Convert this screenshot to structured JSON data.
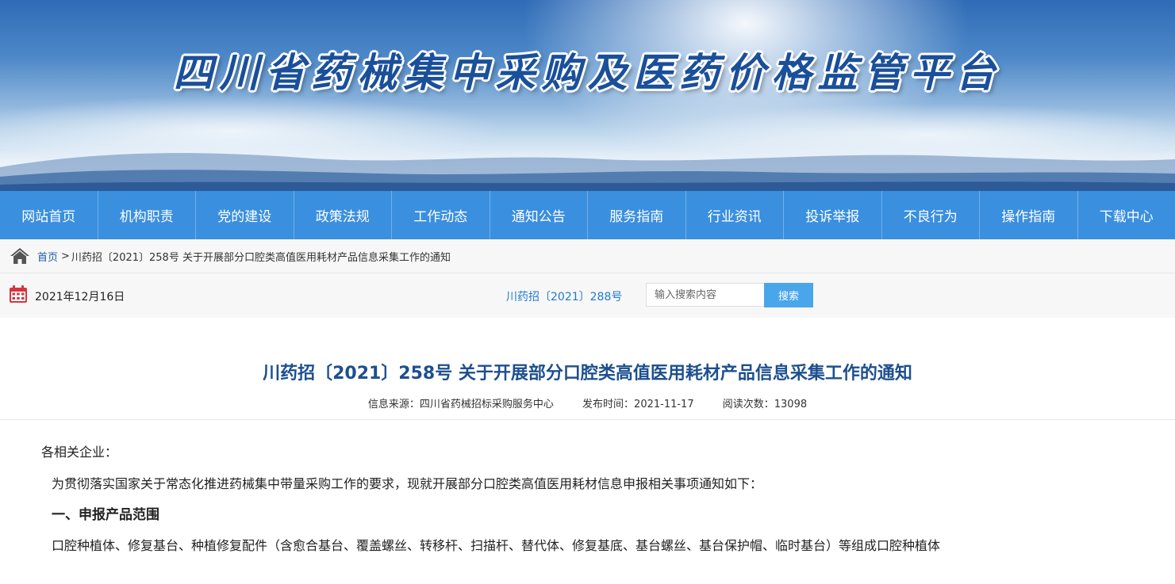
{
  "site": {
    "title": "四川省药械集中采购及医药价格监管平台"
  },
  "nav": {
    "items": [
      "网站首页",
      "机构职责",
      "党的建设",
      "政策法规",
      "工作动态",
      "通知公告",
      "服务指南",
      "行业资讯",
      "投诉举报",
      "不良行为",
      "操作指南",
      "下载中心"
    ]
  },
  "breadcrumb": {
    "home": "首页",
    "separator": ">",
    "current": "川药招〔2021〕258号 关于开展部分口腔类高值医用耗材产品信息采集工作的通知"
  },
  "toolbar": {
    "date": "2021年12月16日",
    "doc_no": "川药招〔2021〕288号",
    "search_placeholder": "输入搜索内容",
    "search_label": "搜索"
  },
  "article": {
    "title": "川药招〔2021〕258号 关于开展部分口腔类高值医用耗材产品信息采集工作的通知",
    "source": "信息来源：四川省药械招标采购服务中心",
    "published": "发布时间：2021-11-17",
    "views": "阅读次数：13098",
    "greeting": "各相关企业：",
    "intro": "为贯彻落实国家关于常态化推进药械集中带量采购工作的要求，现就开展部分口腔类高值医用耗材信息申报相关事项通知如下：",
    "section1_title": "一、申报产品范围",
    "section1_text": "口腔种植体、修复基台、种植修复配件（含愈合基台、覆盖螺丝、转移杆、扫描杆、替代体、修复基底、基台螺丝、基台保护帽、临时基台）等组成口腔种植体"
  },
  "colors": {
    "nav_bg": "#3a8fdf",
    "title_blue": "#1d4f8f",
    "link_blue": "#1e5ea8",
    "search_btn": "#4aa6ea"
  },
  "icons": [
    "home-icon",
    "calendar-icon"
  ]
}
